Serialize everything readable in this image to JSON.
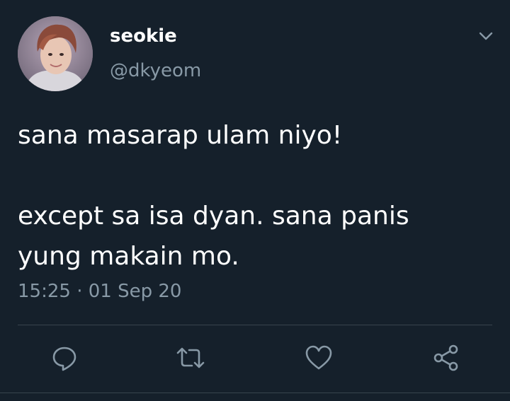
{
  "user": {
    "display_name": "seokie",
    "handle": "@dkyeom"
  },
  "tweet": {
    "lines": [
      "sana masarap ulam niyo!",
      "",
      "except sa isa dyan. sana panis",
      "yung makain mo."
    ],
    "timestamp": "15:25 · 01 Sep 20"
  },
  "actions": [
    {
      "icon": "reply-icon"
    },
    {
      "icon": "retweet-icon"
    },
    {
      "icon": "like-icon"
    },
    {
      "icon": "share-icon"
    }
  ],
  "colors": {
    "background": "#15202b",
    "text": "#ffffff",
    "secondary_text": "#8899a6",
    "divider": "#38444d"
  }
}
